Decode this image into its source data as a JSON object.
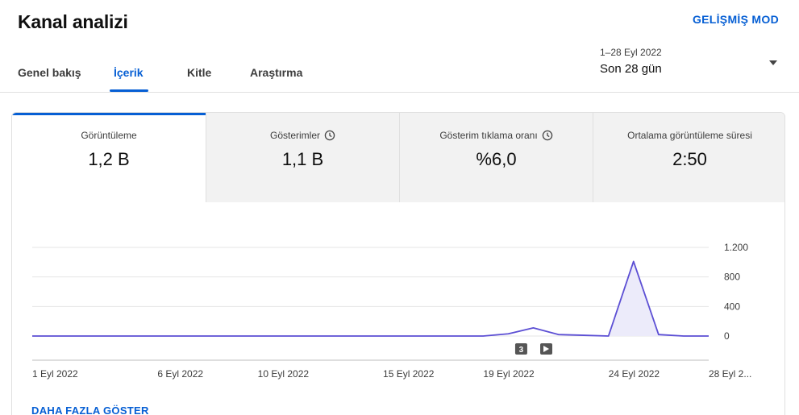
{
  "header": {
    "title": "Kanal analizi",
    "advanced_mode": "GELİŞMİŞ MOD"
  },
  "tabs": [
    {
      "label": "Genel bakış",
      "active": false
    },
    {
      "label": "İçerik",
      "active": true
    },
    {
      "label": "Kitle",
      "active": false
    },
    {
      "label": "Araştırma",
      "active": false
    }
  ],
  "date_picker": {
    "range": "1–28 Eyl 2022",
    "period": "Son 28 gün"
  },
  "metrics": [
    {
      "label": "Görüntüleme",
      "value": "1,2 B",
      "has_clock": false,
      "selected": true
    },
    {
      "label": "Gösterimler",
      "value": "1,1 B",
      "has_clock": true,
      "selected": false
    },
    {
      "label": "Gösterim tıklama oranı",
      "value": "%6,0",
      "has_clock": true,
      "selected": false
    },
    {
      "label": "Ortalama görüntüleme süresi",
      "value": "2:50",
      "has_clock": false,
      "selected": false
    }
  ],
  "show_more": "DAHA FAZLA GÖSTER",
  "colors": {
    "accent": "#065fd4",
    "series": "#5c4fd4",
    "series_fill": "#ecebfa"
  },
  "chart_data": {
    "type": "area",
    "x": [
      "1 Eyl 2022",
      "2 Eyl 2022",
      "3 Eyl 2022",
      "4 Eyl 2022",
      "5 Eyl 2022",
      "6 Eyl 2022",
      "7 Eyl 2022",
      "8 Eyl 2022",
      "9 Eyl 2022",
      "10 Eyl 2022",
      "11 Eyl 2022",
      "12 Eyl 2022",
      "13 Eyl 2022",
      "14 Eyl 2022",
      "15 Eyl 2022",
      "16 Eyl 2022",
      "17 Eyl 2022",
      "18 Eyl 2022",
      "19 Eyl 2022",
      "20 Eyl 2022",
      "21 Eyl 2022",
      "22 Eyl 2022",
      "23 Eyl 2022",
      "24 Eyl 2022",
      "25 Eyl 2022",
      "26 Eyl 2022",
      "27 Eyl 2022",
      "28 Eyl 2022"
    ],
    "values": [
      0,
      0,
      0,
      0,
      0,
      0,
      0,
      0,
      0,
      0,
      0,
      0,
      0,
      0,
      0,
      0,
      0,
      0,
      0,
      30,
      110,
      20,
      10,
      0,
      1010,
      20,
      0,
      0
    ],
    "tick_labels": [
      {
        "index": 0,
        "label": "1 Eyl 2022"
      },
      {
        "index": 5,
        "label": "6 Eyl 2022"
      },
      {
        "index": 9,
        "label": "10 Eyl 2022"
      },
      {
        "index": 14,
        "label": "15 Eyl 2022"
      },
      {
        "index": 18,
        "label": "19 Eyl 2022"
      },
      {
        "index": 23,
        "label": "24 Eyl 2022"
      },
      {
        "index": 27,
        "label": "28 Eyl 2..."
      }
    ],
    "y_ticks": [
      0,
      400,
      800,
      1200
    ],
    "y_tick_labels": [
      "0",
      "400",
      "800",
      "1.200"
    ],
    "ylim": [
      0,
      1200
    ],
    "fill_from_index": 23,
    "markers": [
      {
        "index": 19.5,
        "type": "count",
        "label": "3"
      },
      {
        "index": 20.5,
        "type": "play",
        "label": ""
      }
    ],
    "grid": true
  }
}
